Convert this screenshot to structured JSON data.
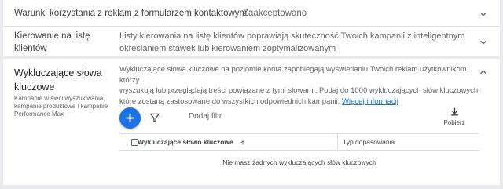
{
  "row1": {
    "label": "Warunki korzystania z reklam z formularzem kontaktowym",
    "value": "Zaakceptowano"
  },
  "row2": {
    "label_line1": "Kierowanie na listę",
    "label_line2": "klientów",
    "value_line1": "Listy kierowania na listę klientów poprawiają skuteczność Twoich kampanii z inteligentnym",
    "value_line2": "określaniem stawek lub kierowaniem zoptymalizowanym"
  },
  "section": {
    "title_line1": "Wykluczające słowa",
    "title_line2": "kluczowe",
    "subtitle_line1": "Kampanie w sieci wyszukiwania,",
    "subtitle_line2": "kampanie produktowe i kampanie",
    "subtitle_line3": "Performance Max",
    "desc_line1": "Wykluczające słowa kluczowe na poziomie konta zapobiegają wyświetlaniu Twoich reklam użytkownikom, którzy",
    "desc_line2": "wyszukują lub przeglądają treści powiązane z tymi słowami. Podaj do 1000 wykluczających słów kluczowych,",
    "desc_line3": "które zostaną zastosowane do wszystkich odpowiednich kampanii.",
    "learn_more": "Więcej informacji",
    "filter_label": "Dodaj filtr",
    "download_label": "Pobierz",
    "table": {
      "headers": [
        "Wykluczające słowo kluczowe",
        "Typ dopasowania"
      ],
      "empty_text": "Nie masz żadnych wykluczających słów kluczowych"
    }
  },
  "colors": {
    "accent": "#1a73e8",
    "background": "#e8eaed"
  },
  "icons": [
    "chevron-down-icon",
    "chevron-up-icon",
    "plus-icon",
    "filter-icon",
    "download-icon",
    "sort-arrow-up-icon"
  ]
}
